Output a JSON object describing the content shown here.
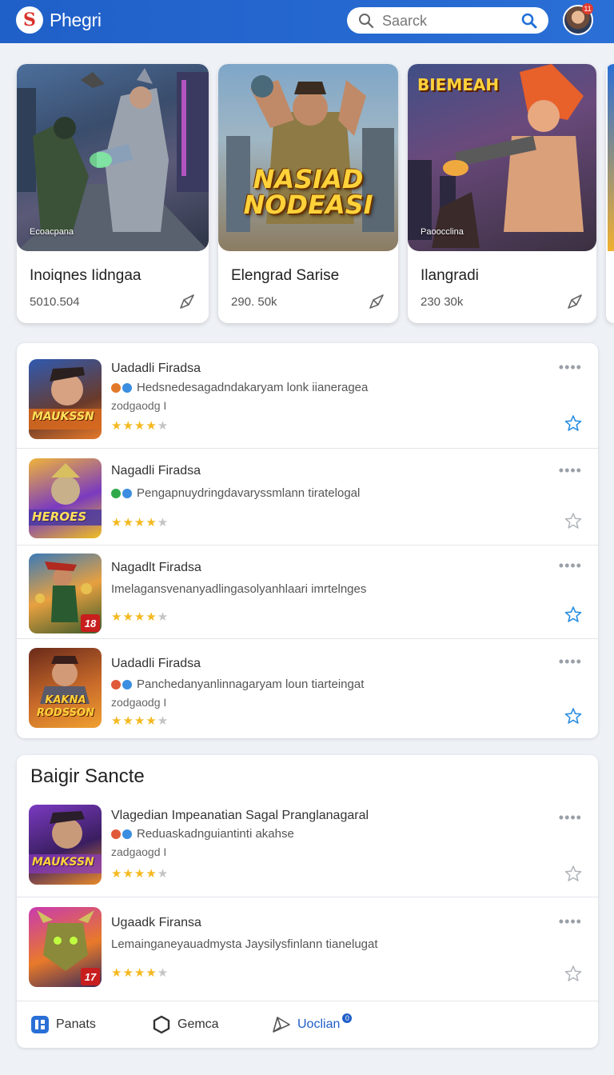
{
  "header": {
    "logo_glyph": "S",
    "app_title": "Phegri",
    "search_placeholder": "Saarck",
    "avatar_badge": "11"
  },
  "featured": [
    {
      "art_label": "Ecoacpana",
      "art_title": "",
      "art_top": "",
      "name": "Inoiqnes Iidngaa",
      "count": "5010.504"
    },
    {
      "art_label": "",
      "art_title": "NASIAD NODEASI",
      "art_top": "",
      "name": "Elengrad Sarise",
      "count": "290. 50k"
    },
    {
      "art_label": "Paoocclina",
      "art_title": "",
      "art_top": "BIEMEAH",
      "name": "Ilangradi",
      "count": "230 30k"
    }
  ],
  "list": [
    {
      "title": "Uadadli Firadsa",
      "desc": "Hedsnedesagadndakaryam lonk iianeragea",
      "sub": "zodgaodg I",
      "rating": 4,
      "thumb_text": "MAUKSSN",
      "fav_active": true,
      "dot_colors": [
        "#e07a2a",
        "#3b8ee0"
      ]
    },
    {
      "title": "Nagadli Firadsa",
      "desc": "Pengapnuydringdavaryssmlann tiratelogal",
      "sub": "",
      "rating": 4,
      "thumb_text": "HEROES",
      "fav_active": false,
      "dot_colors": [
        "#2eaa4a",
        "#3b8ee0"
      ]
    },
    {
      "title": "Nagadlt Firadsa",
      "desc": "Imelagansvenanyadlingasolyanhlaari imrtelnges",
      "sub": "",
      "rating": 4,
      "thumb_text": "",
      "thumb_badge": "18",
      "fav_active": true,
      "dot_colors": []
    },
    {
      "title": "Uadadli Firadsa",
      "desc": "Panchedanyanlinnagaryam loun tiarteingat",
      "sub": "zodgaodg I",
      "rating": 4,
      "thumb_text": "KAKNA RODSSON",
      "fav_active": true,
      "dot_colors": [
        "#e05a3a",
        "#3b8ee0"
      ]
    }
  ],
  "section": {
    "title": "Baigir Sancte",
    "items": [
      {
        "title": "Vlagedian Impeanatian Sagal Pranglanagaral",
        "desc": "Reduaskadnguiantinti akahse",
        "sub": "zadgaogd I",
        "rating": 4,
        "thumb_text": "MAUKSSN",
        "fav_active": false,
        "dot_colors": [
          "#e05a3a",
          "#3b8ee0"
        ]
      },
      {
        "title": "Ugaadk Firansa",
        "desc": "Lemainganeyauadmysta Jaysilysfinlann tianelugat",
        "sub": "",
        "rating": 4,
        "thumb_text": "",
        "thumb_badge": "17",
        "fav_active": false,
        "dot_colors": []
      }
    ]
  },
  "tabs": [
    {
      "label": "Panats",
      "icon": "grid-app-icon",
      "accent": "#2a6fd6"
    },
    {
      "label": "Gemca",
      "icon": "hexagon-icon",
      "accent": "#333"
    },
    {
      "label": "Uoclian",
      "icon": "send-icon",
      "accent": "#1f5fc8",
      "badge": "0"
    }
  ],
  "colors": {
    "brand": "#1f5fc8",
    "star": "#f5b920",
    "fav_active": "#2a8ee0",
    "fav_inactive": "#b0b4ba"
  }
}
